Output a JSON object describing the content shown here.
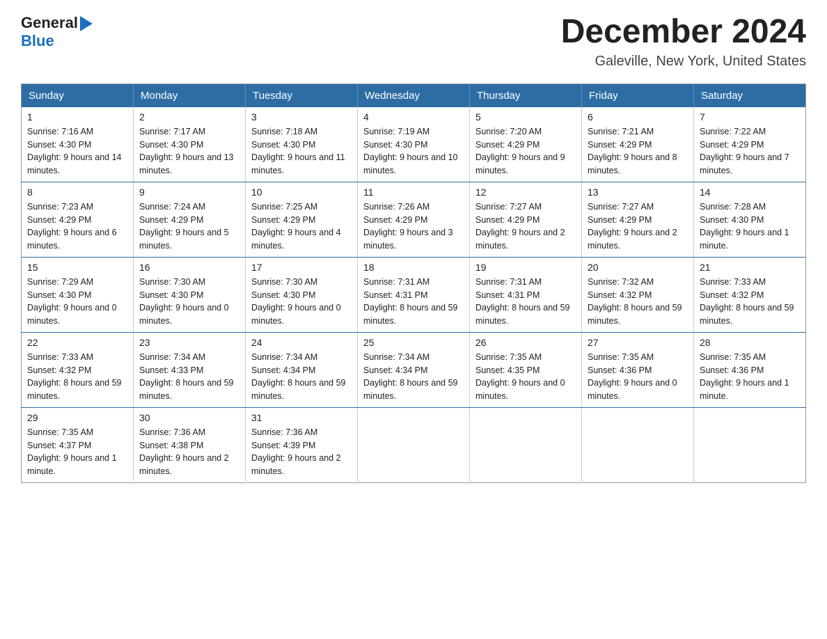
{
  "header": {
    "logo_general": "General",
    "logo_blue": "Blue",
    "month_title": "December 2024",
    "location": "Galeville, New York, United States"
  },
  "weekdays": [
    "Sunday",
    "Monday",
    "Tuesday",
    "Wednesday",
    "Thursday",
    "Friday",
    "Saturday"
  ],
  "weeks": [
    [
      {
        "day": "1",
        "sunrise": "7:16 AM",
        "sunset": "4:30 PM",
        "daylight": "9 hours and 14 minutes."
      },
      {
        "day": "2",
        "sunrise": "7:17 AM",
        "sunset": "4:30 PM",
        "daylight": "9 hours and 13 minutes."
      },
      {
        "day": "3",
        "sunrise": "7:18 AM",
        "sunset": "4:30 PM",
        "daylight": "9 hours and 11 minutes."
      },
      {
        "day": "4",
        "sunrise": "7:19 AM",
        "sunset": "4:30 PM",
        "daylight": "9 hours and 10 minutes."
      },
      {
        "day": "5",
        "sunrise": "7:20 AM",
        "sunset": "4:29 PM",
        "daylight": "9 hours and 9 minutes."
      },
      {
        "day": "6",
        "sunrise": "7:21 AM",
        "sunset": "4:29 PM",
        "daylight": "9 hours and 8 minutes."
      },
      {
        "day": "7",
        "sunrise": "7:22 AM",
        "sunset": "4:29 PM",
        "daylight": "9 hours and 7 minutes."
      }
    ],
    [
      {
        "day": "8",
        "sunrise": "7:23 AM",
        "sunset": "4:29 PM",
        "daylight": "9 hours and 6 minutes."
      },
      {
        "day": "9",
        "sunrise": "7:24 AM",
        "sunset": "4:29 PM",
        "daylight": "9 hours and 5 minutes."
      },
      {
        "day": "10",
        "sunrise": "7:25 AM",
        "sunset": "4:29 PM",
        "daylight": "9 hours and 4 minutes."
      },
      {
        "day": "11",
        "sunrise": "7:26 AM",
        "sunset": "4:29 PM",
        "daylight": "9 hours and 3 minutes."
      },
      {
        "day": "12",
        "sunrise": "7:27 AM",
        "sunset": "4:29 PM",
        "daylight": "9 hours and 2 minutes."
      },
      {
        "day": "13",
        "sunrise": "7:27 AM",
        "sunset": "4:29 PM",
        "daylight": "9 hours and 2 minutes."
      },
      {
        "day": "14",
        "sunrise": "7:28 AM",
        "sunset": "4:30 PM",
        "daylight": "9 hours and 1 minute."
      }
    ],
    [
      {
        "day": "15",
        "sunrise": "7:29 AM",
        "sunset": "4:30 PM",
        "daylight": "9 hours and 0 minutes."
      },
      {
        "day": "16",
        "sunrise": "7:30 AM",
        "sunset": "4:30 PM",
        "daylight": "9 hours and 0 minutes."
      },
      {
        "day": "17",
        "sunrise": "7:30 AM",
        "sunset": "4:30 PM",
        "daylight": "9 hours and 0 minutes."
      },
      {
        "day": "18",
        "sunrise": "7:31 AM",
        "sunset": "4:31 PM",
        "daylight": "8 hours and 59 minutes."
      },
      {
        "day": "19",
        "sunrise": "7:31 AM",
        "sunset": "4:31 PM",
        "daylight": "8 hours and 59 minutes."
      },
      {
        "day": "20",
        "sunrise": "7:32 AM",
        "sunset": "4:32 PM",
        "daylight": "8 hours and 59 minutes."
      },
      {
        "day": "21",
        "sunrise": "7:33 AM",
        "sunset": "4:32 PM",
        "daylight": "8 hours and 59 minutes."
      }
    ],
    [
      {
        "day": "22",
        "sunrise": "7:33 AM",
        "sunset": "4:32 PM",
        "daylight": "8 hours and 59 minutes."
      },
      {
        "day": "23",
        "sunrise": "7:34 AM",
        "sunset": "4:33 PM",
        "daylight": "8 hours and 59 minutes."
      },
      {
        "day": "24",
        "sunrise": "7:34 AM",
        "sunset": "4:34 PM",
        "daylight": "8 hours and 59 minutes."
      },
      {
        "day": "25",
        "sunrise": "7:34 AM",
        "sunset": "4:34 PM",
        "daylight": "8 hours and 59 minutes."
      },
      {
        "day": "26",
        "sunrise": "7:35 AM",
        "sunset": "4:35 PM",
        "daylight": "9 hours and 0 minutes."
      },
      {
        "day": "27",
        "sunrise": "7:35 AM",
        "sunset": "4:36 PM",
        "daylight": "9 hours and 0 minutes."
      },
      {
        "day": "28",
        "sunrise": "7:35 AM",
        "sunset": "4:36 PM",
        "daylight": "9 hours and 1 minute."
      }
    ],
    [
      {
        "day": "29",
        "sunrise": "7:35 AM",
        "sunset": "4:37 PM",
        "daylight": "9 hours and 1 minute."
      },
      {
        "day": "30",
        "sunrise": "7:36 AM",
        "sunset": "4:38 PM",
        "daylight": "9 hours and 2 minutes."
      },
      {
        "day": "31",
        "sunrise": "7:36 AM",
        "sunset": "4:39 PM",
        "daylight": "9 hours and 2 minutes."
      },
      null,
      null,
      null,
      null
    ]
  ],
  "labels": {
    "sunrise": "Sunrise:",
    "sunset": "Sunset:",
    "daylight": "Daylight:"
  }
}
